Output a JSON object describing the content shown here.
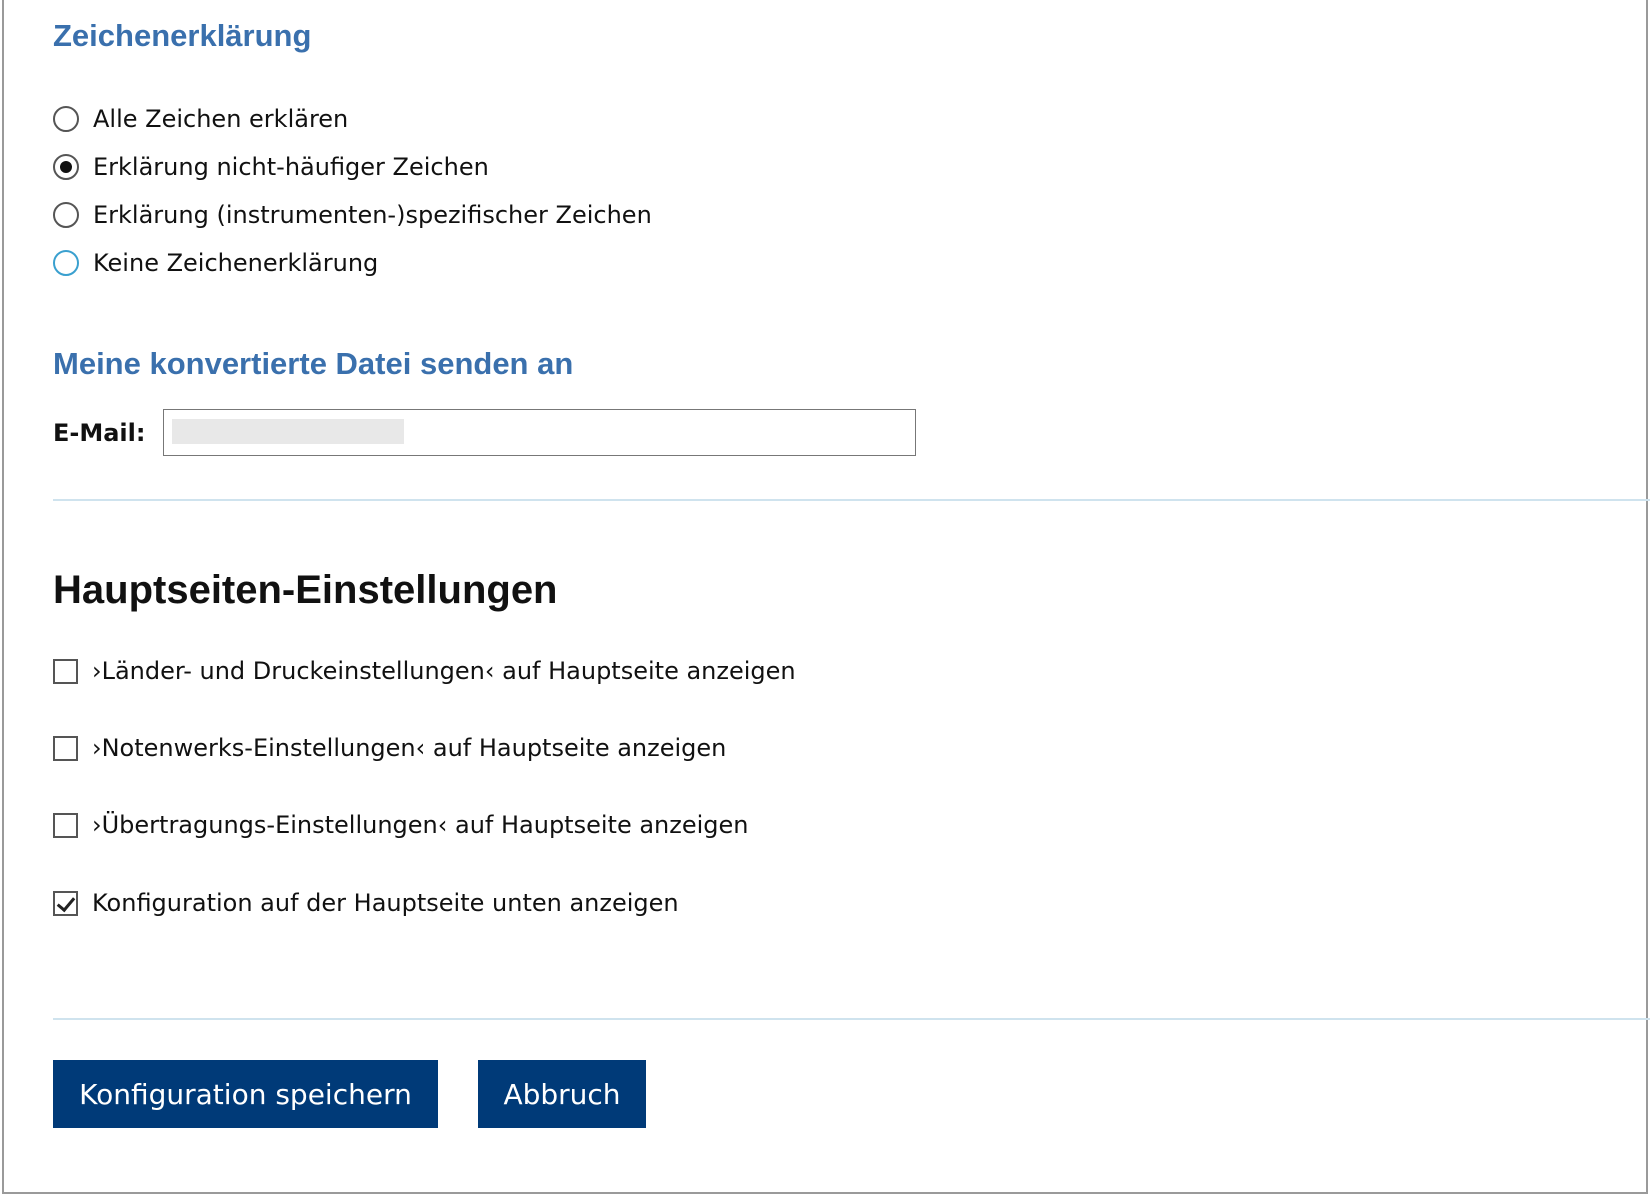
{
  "legend": {
    "title": "Zeichenerklärung",
    "options": [
      {
        "label": "Alle Zeichen erklären",
        "checked": false,
        "focused": false
      },
      {
        "label": "Erklärung nicht-häufiger Zeichen",
        "checked": true,
        "focused": false
      },
      {
        "label": "Erklärung (instrumenten-)spezifischer Zeichen",
        "checked": false,
        "focused": false
      },
      {
        "label": "Keine Zeichenerklärung",
        "checked": false,
        "focused": true
      }
    ]
  },
  "send": {
    "title": "Meine konvertierte Datei senden an",
    "email_label": "E-Mail:",
    "email_value": ""
  },
  "main_settings": {
    "heading": "Hauptseiten-Einstellungen",
    "checkboxes": [
      {
        "label": "›Länder- und Druckeinstellungen‹ auf Hauptseite anzeigen",
        "checked": false
      },
      {
        "label": "›Notenwerks-Einstellungen‹ auf Hauptseite anzeigen",
        "checked": false
      },
      {
        "label": "›Übertragungs-Einstellungen‹ auf Hauptseite anzeigen",
        "checked": false
      },
      {
        "label": "Konfiguration auf der Hauptseite unten anzeigen",
        "checked": true
      }
    ]
  },
  "buttons": {
    "save_label": "Konfiguration speichern",
    "cancel_label": "Abbruch"
  },
  "colors": {
    "section_title": "#3a70ad",
    "button_bg": "#003a78",
    "radio_focus": "#3aa0cf",
    "divider": "#cfe3ee"
  }
}
